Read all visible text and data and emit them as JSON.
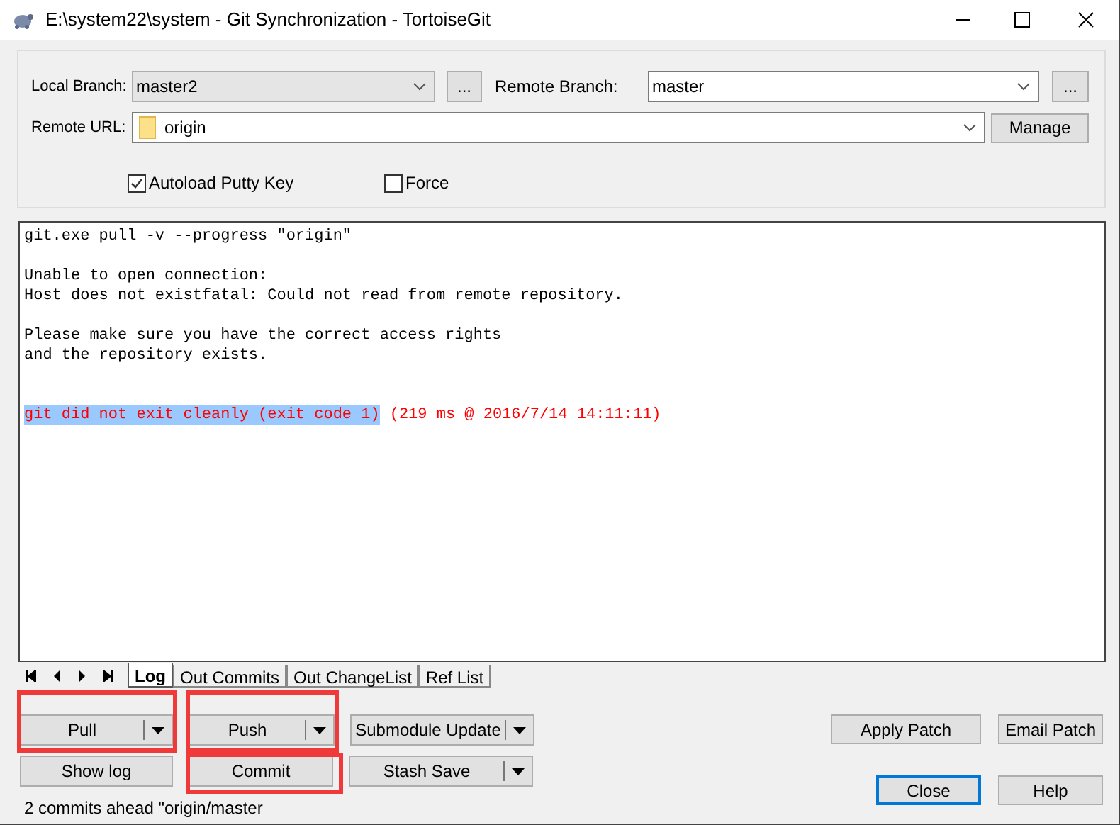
{
  "window": {
    "title": "E:\\system22\\system - Git Synchronization - TortoiseGit"
  },
  "local_branch": {
    "label": "Local Branch:",
    "value": "master2",
    "browse": "..."
  },
  "remote_branch": {
    "label": "Remote Branch:",
    "value": "master",
    "browse": "..."
  },
  "remote_url": {
    "label": "Remote URL:",
    "value": "origin",
    "button": "Manage"
  },
  "options": [
    {
      "label": "Autoload Putty Key",
      "checked": true
    },
    {
      "label": "Force",
      "checked": false
    }
  ],
  "log": [
    {
      "kind": "text",
      "text": "git.exe pull -v --progress \"origin\""
    },
    {
      "kind": "blank"
    },
    {
      "kind": "text",
      "text": "Unable to open connection:"
    },
    {
      "kind": "text",
      "text": "Host does not existfatal: Could not read from remote repository."
    },
    {
      "kind": "blank"
    },
    {
      "kind": "text",
      "text": "Please make sure you have the correct access rights"
    },
    {
      "kind": "text",
      "text": "and the repository exists."
    },
    {
      "kind": "blank"
    },
    {
      "kind": "blank"
    },
    {
      "kind": "error",
      "parts": [
        {
          "text": "git did not exit cleanly (exit code 1)",
          "selected": true
        },
        {
          "text": "(219 ms @ 2016/7/14 14:11:11)",
          "selected": false
        }
      ]
    }
  ],
  "tabs": [
    {
      "label": "Log",
      "selected": true
    },
    {
      "label": "Out Commits",
      "selected": false
    },
    {
      "label": "Out ChangeList",
      "selected": false
    },
    {
      "label": "Ref List",
      "selected": false
    }
  ],
  "button_rows": [
    [
      {
        "label": "Pull",
        "kind": "split",
        "annotated": true
      },
      {
        "label": "Push",
        "kind": "split",
        "annotated": true
      },
      {
        "label": "Submodule Update",
        "kind": "split",
        "annotated": false
      }
    ],
    [
      {
        "label": "Show log",
        "kind": "plain",
        "annotated": false
      },
      {
        "label": "Commit",
        "kind": "plain",
        "annotated": true
      },
      {
        "label": "Stash Save",
        "kind": "split",
        "annotated": false
      }
    ]
  ],
  "patch_buttons": [
    "Apply Patch",
    "Email Patch"
  ],
  "status": "2 commits ahead \"origin/master",
  "dialog_buttons": [
    {
      "label": "Close",
      "default": true
    },
    {
      "label": "Help",
      "default": false
    }
  ]
}
